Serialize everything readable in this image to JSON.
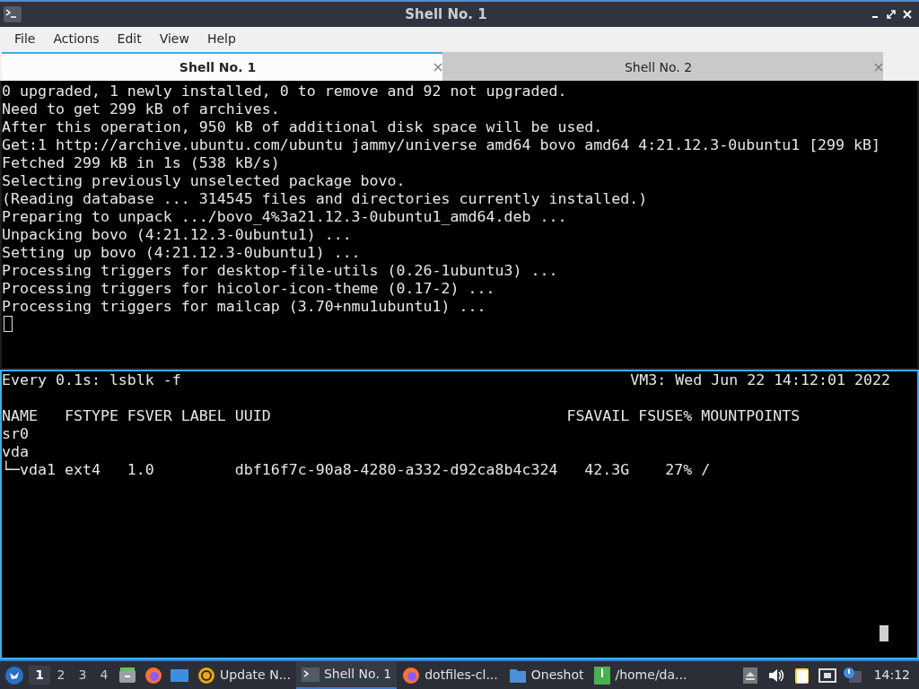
{
  "window": {
    "title": "Shell No. 1"
  },
  "menu": [
    "File",
    "Actions",
    "Edit",
    "View",
    "Help"
  ],
  "tabs": [
    {
      "label": "Shell No. 1",
      "selected": true
    },
    {
      "label": "Shell No. 2",
      "selected": false
    }
  ],
  "upper_pane": {
    "lines": [
      "0 upgraded, 1 newly installed, 0 to remove and 92 not upgraded.",
      "Need to get 299 kB of archives.",
      "After this operation, 950 kB of additional disk space will be used.",
      "Get:1 http://archive.ubuntu.com/ubuntu jammy/universe amd64 bovo amd64 4:21.12.3-0ubuntu1 [299 kB]",
      "Fetched 299 kB in 1s (538 kB/s)",
      "Selecting previously unselected package bovo.",
      "(Reading database ... 314545 files and directories currently installed.)",
      "Preparing to unpack .../bovo_4%3a21.12.3-0ubuntu1_amd64.deb ...",
      "Unpacking bovo (4:21.12.3-0ubuntu1) ...",
      "Setting up bovo (4:21.12.3-0ubuntu1) ...",
      "Processing triggers for desktop-file-utils (0.26-1ubuntu3) ...",
      "Processing triggers for hicolor-icon-theme (0.17-2) ...",
      "Processing triggers for mailcap (3.70+nmu1ubuntu1) ..."
    ]
  },
  "lower_pane": {
    "command": "Every 0.1s: lsblk -f",
    "host_time": "VM3: Wed Jun 22 14:12:01 2022",
    "lines": [
      "NAME   FSTYPE FSVER LABEL UUID                                 FSAVAIL FSUSE% MOUNTPOINTS",
      "sr0",
      "vda",
      "└─vda1 ext4   1.0         dbf16f7c-90a8-4280-a332-d92ca8b4c324   42.3G    27% /"
    ]
  },
  "taskbar": {
    "workspaces": [
      {
        "label": "1",
        "selected": true
      },
      {
        "label": "2",
        "selected": false
      },
      {
        "label": "3",
        "selected": false
      },
      {
        "label": "4",
        "selected": false
      }
    ],
    "tasks": [
      {
        "label": "Update N...",
        "kind": "updater",
        "selected": false
      },
      {
        "label": "Shell No. 1",
        "kind": "terminal",
        "selected": true
      },
      {
        "label": "dotfiles-cl...",
        "kind": "browser",
        "selected": false
      },
      {
        "label": "Oneshot",
        "kind": "folder",
        "selected": false
      },
      {
        "label": "/home/da...",
        "kind": "archive",
        "selected": false
      }
    ],
    "clock": "14:12"
  }
}
